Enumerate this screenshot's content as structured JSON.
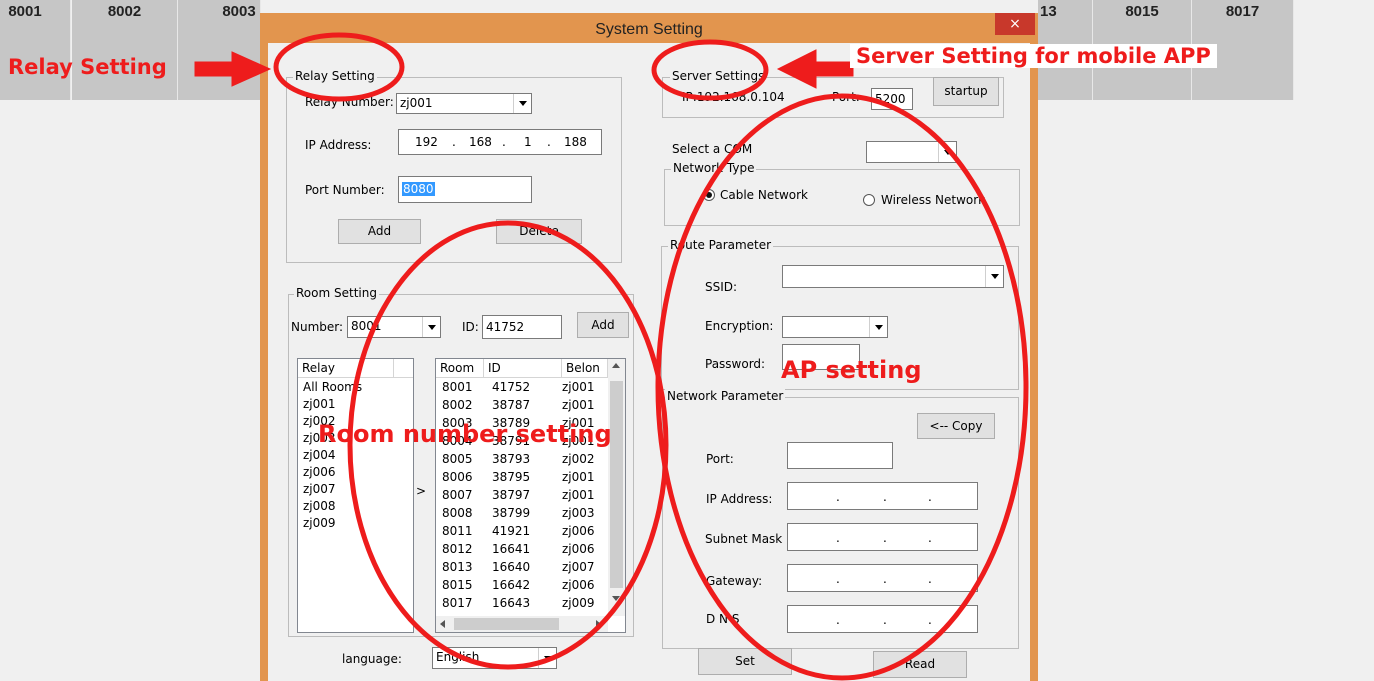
{
  "background_rooms": [
    "8001",
    "8002",
    "8003",
    "13",
    "8015",
    "8017"
  ],
  "dialog": {
    "title": "System Setting",
    "close_glyph": "×",
    "relay_setting": {
      "group_title": "Relay Setting",
      "relay_number_label": "Relay Number:",
      "relay_number_value": "zj001",
      "ip_label": "IP Address:",
      "ip": [
        "192",
        "168",
        "1",
        "188"
      ],
      "port_label": "Port Number:",
      "port_value": "8080",
      "add_label": "Add",
      "delete_label": "Delete"
    },
    "room_setting": {
      "group_title": "Room Setting",
      "number_label": "Number:",
      "number_value": "8001",
      "id_label": "ID:",
      "id_value": "41752",
      "add_label": "Add",
      "relay_list_header": "Relay",
      "relay_list": [
        "All Rooms",
        "zj001",
        "zj002",
        "zj003",
        "zj004",
        "zj006",
        "zj007",
        "zj008",
        "zj009"
      ],
      "move_glyph": ">",
      "room_table_headers": [
        "Room",
        "ID",
        "Belon"
      ],
      "room_table_rows": [
        [
          "8001",
          "41752",
          "zj001"
        ],
        [
          "8002",
          "38787",
          "zj001"
        ],
        [
          "8003",
          "38789",
          "zj001"
        ],
        [
          "8004",
          "38791",
          "zj001"
        ],
        [
          "8005",
          "38793",
          "zj002"
        ],
        [
          "8006",
          "38795",
          "zj001"
        ],
        [
          "8007",
          "38797",
          "zj001"
        ],
        [
          "8008",
          "38799",
          "zj003"
        ],
        [
          "8011",
          "41921",
          "zj006"
        ],
        [
          "8012",
          "16641",
          "zj006"
        ],
        [
          "8013",
          "16640",
          "zj007"
        ],
        [
          "8015",
          "16642",
          "zj006"
        ],
        [
          "8017",
          "16643",
          "zj009"
        ]
      ]
    },
    "language_label": "language:",
    "language_value": "English",
    "server_settings": {
      "group_title": "Server Settings",
      "ip_text": "IP:192.168.0.104",
      "port_label": "Port:",
      "port_value": "5200",
      "startup_label": "startup"
    },
    "select_com_label": "Select a COM",
    "network_type": {
      "group_title": "Network Type",
      "cable_label": "Cable Network",
      "wireless_label": "Wireless Network",
      "selected": "Cable Network"
    },
    "route_parameter": {
      "group_title": "Route Parameter",
      "ssid_label": "SSID:",
      "encryption_label": "Encryption:",
      "password_label": "Password:"
    },
    "network_parameter": {
      "group_title": "Network Parameter",
      "copy_label": "<-- Copy",
      "port_label": "Port:",
      "ip_label": "IP Address:",
      "subnet_label": "Subnet Mask",
      "gateway_label": "Gateway:",
      "dns_label": "D N S"
    },
    "set_label": "Set",
    "read_label": "Read"
  },
  "annotations": {
    "relay": "Relay Setting",
    "server": "Server Setting for mobile APP",
    "ap": "AP setting",
    "room": "Room number setting",
    "color": "#ee1c1c"
  }
}
